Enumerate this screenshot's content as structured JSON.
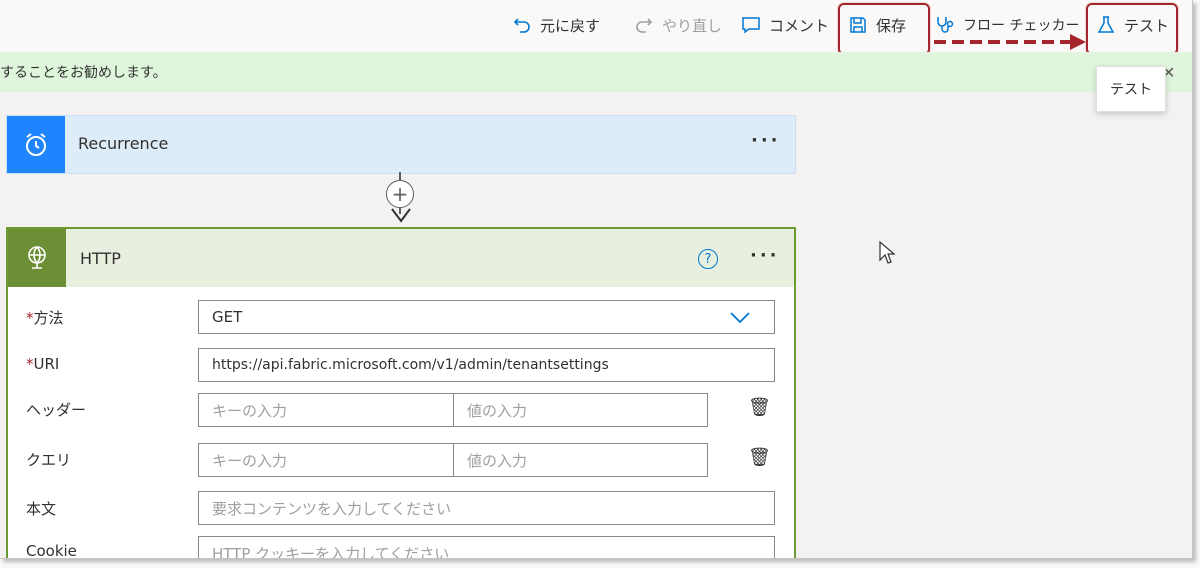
{
  "toolbar": {
    "undo": "元に戻す",
    "redo": "やり直し",
    "comment": "コメント",
    "save": "保存",
    "checker": "フロー チェッカー",
    "test": "テスト"
  },
  "banner": {
    "text": "することをお勧めします。"
  },
  "tooltip": {
    "text": "テスト"
  },
  "recurrence": {
    "title": "Recurrence",
    "menu": "···"
  },
  "http": {
    "title": "HTTP",
    "menu": "···",
    "help": "?",
    "fields": {
      "method_label": "方法",
      "method_value": "GET",
      "uri_label": "URI",
      "uri_value": "https://api.fabric.microsoft.com/v1/admin/tenantsettings",
      "headers_label": "ヘッダー",
      "key_placeholder": "キーの入力",
      "value_placeholder": "値の入力",
      "query_label": "クエリ",
      "body_label": "本文",
      "body_placeholder": "要求コンテンツを入力してください",
      "cookie_label": "Cookie",
      "cookie_placeholder": "HTTP クッキーを入力してください"
    }
  },
  "colors": {
    "accent": "#0078d4",
    "highlight": "#a4262c",
    "recurrence_icon_bg": "#1f85ff",
    "http_icon_bg": "#6c8e35",
    "banner_bg": "#dff6dd"
  },
  "icons": [
    "undo-icon",
    "redo-icon",
    "comment-icon",
    "save-icon",
    "stethoscope-icon",
    "flask-icon",
    "alarm-clock-icon",
    "globe-icon",
    "help-icon",
    "trash-icon",
    "chevron-down-icon",
    "plus-icon",
    "cursor-icon"
  ]
}
